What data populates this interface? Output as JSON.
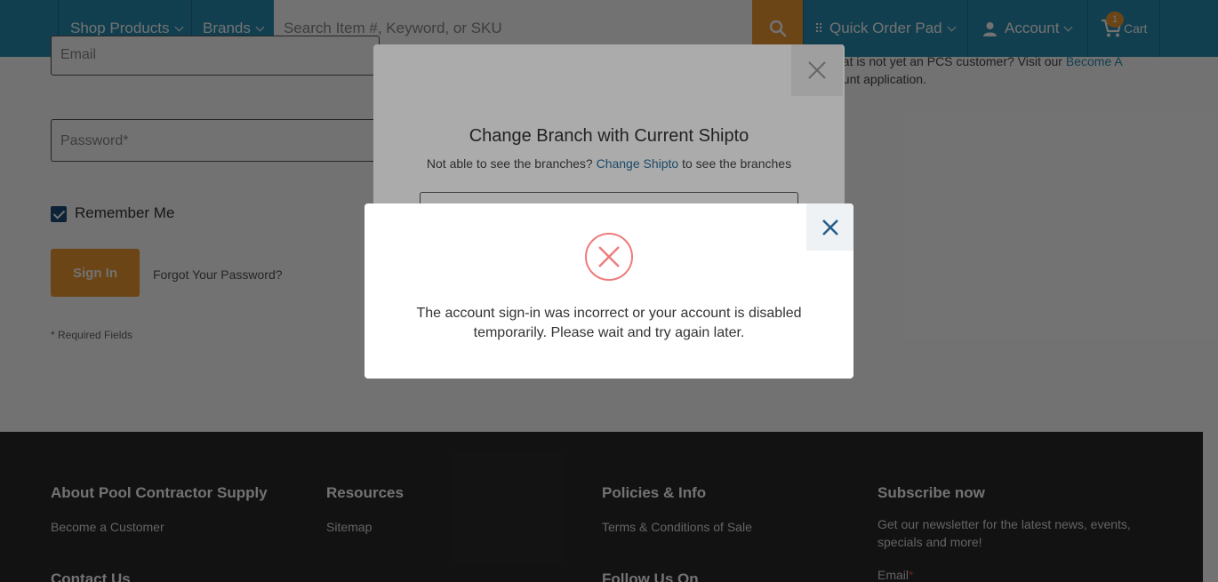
{
  "header": {
    "shop_products": "Shop Products",
    "brands": "Brands",
    "search_placeholder": "Search Item #, Keyword, or SKU",
    "quick_order": "Quick Order Pad",
    "account": "Account",
    "cart": "Cart",
    "cart_count": "1"
  },
  "login": {
    "email_label": "Email",
    "password_label": "Password*",
    "remember": "Remember Me",
    "signin": "Sign In",
    "forgot": "Forgot Your Password?",
    "required": "* Required Fields",
    "side_text_1": "hat is not yet an PCS customer? Visit our",
    "side_link": "Become A",
    "side_text_2": "ount application."
  },
  "branch_modal": {
    "title": "Change Branch with Current Shipto",
    "sub_prefix": "Not able to see the branches?",
    "sub_link": "Change Shipto",
    "sub_suffix": "to see the branches"
  },
  "error_modal": {
    "message": "The account sign-in was incorrect or your account is disabled temporarily. Please wait and try again later."
  },
  "footer": {
    "col1_title": "About Pool Contractor Supply",
    "col1_link": "Become a Customer",
    "col1_title2": "Contact Us",
    "col2_title": "Resources",
    "col2_link": "Sitemap",
    "col3_title": "Policies & Info",
    "col3_link": "Terms & Conditions of Sale",
    "col3_title2": "Follow Us On",
    "col4_title": "Subscribe now",
    "col4_text": "Get our newsletter for the latest news, events, specials and more!",
    "col4_email": "Email",
    "col4_required_mark": "*"
  },
  "colors": {
    "header": "#2a8cb0",
    "accent": "#f29b33",
    "footer": "#2a2a2a",
    "error": "#ef7b7b",
    "checkbox": "#1f4e79"
  }
}
